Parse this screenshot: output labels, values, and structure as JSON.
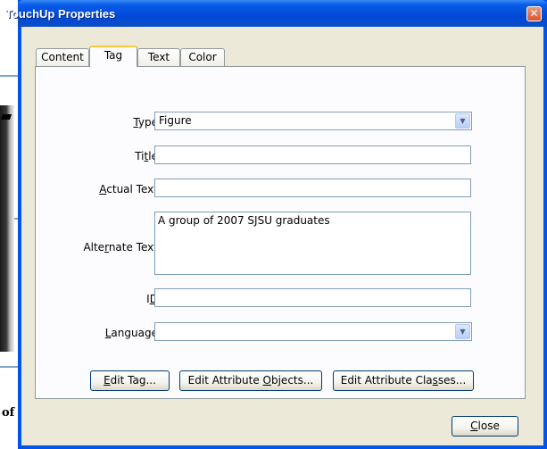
{
  "window": {
    "title": "TouchUp Properties",
    "close_glyph": "✕"
  },
  "background": {
    "caption_fragment": "of"
  },
  "tabs": [
    {
      "label": "Content"
    },
    {
      "label": "Tag",
      "active": true
    },
    {
      "label": "Text"
    },
    {
      "label": "Color"
    }
  ],
  "form": {
    "type": {
      "pre": "",
      "key": "T",
      "post": "ype:",
      "value": "Figure"
    },
    "title": {
      "pre": "Ti",
      "key": "t",
      "post": "le:",
      "value": ""
    },
    "actual_text": {
      "pre": "",
      "key": "A",
      "post": "ctual Text:",
      "value": ""
    },
    "alternate_text": {
      "pre": "Alte",
      "key": "r",
      "post": "nate Text:",
      "value": "A group of 2007 SJSU graduates"
    },
    "id": {
      "pre": "I",
      "key": "D",
      "post": ":",
      "value": ""
    },
    "language": {
      "pre": "",
      "key": "L",
      "post": "anguage:",
      "value": ""
    }
  },
  "buttons": {
    "edit_tag": {
      "pre": "",
      "key": "E",
      "post": "dit Tag..."
    },
    "edit_attribute_objects": {
      "pre": "Edit Attribute ",
      "key": "O",
      "post": "bjects..."
    },
    "edit_attribute_classes": {
      "pre": "Edit Attribute Cla",
      "key": "s",
      "post": "ses..."
    },
    "close": {
      "pre": "",
      "key": "C",
      "post": "lose"
    }
  },
  "icons": {
    "dropdown": "chevron-down-icon",
    "close": "close-icon"
  },
  "colors": {
    "titlebar": "#0055ea",
    "dialog_face": "#ece9d8",
    "active_tab_highlight": "#ffc83c"
  }
}
